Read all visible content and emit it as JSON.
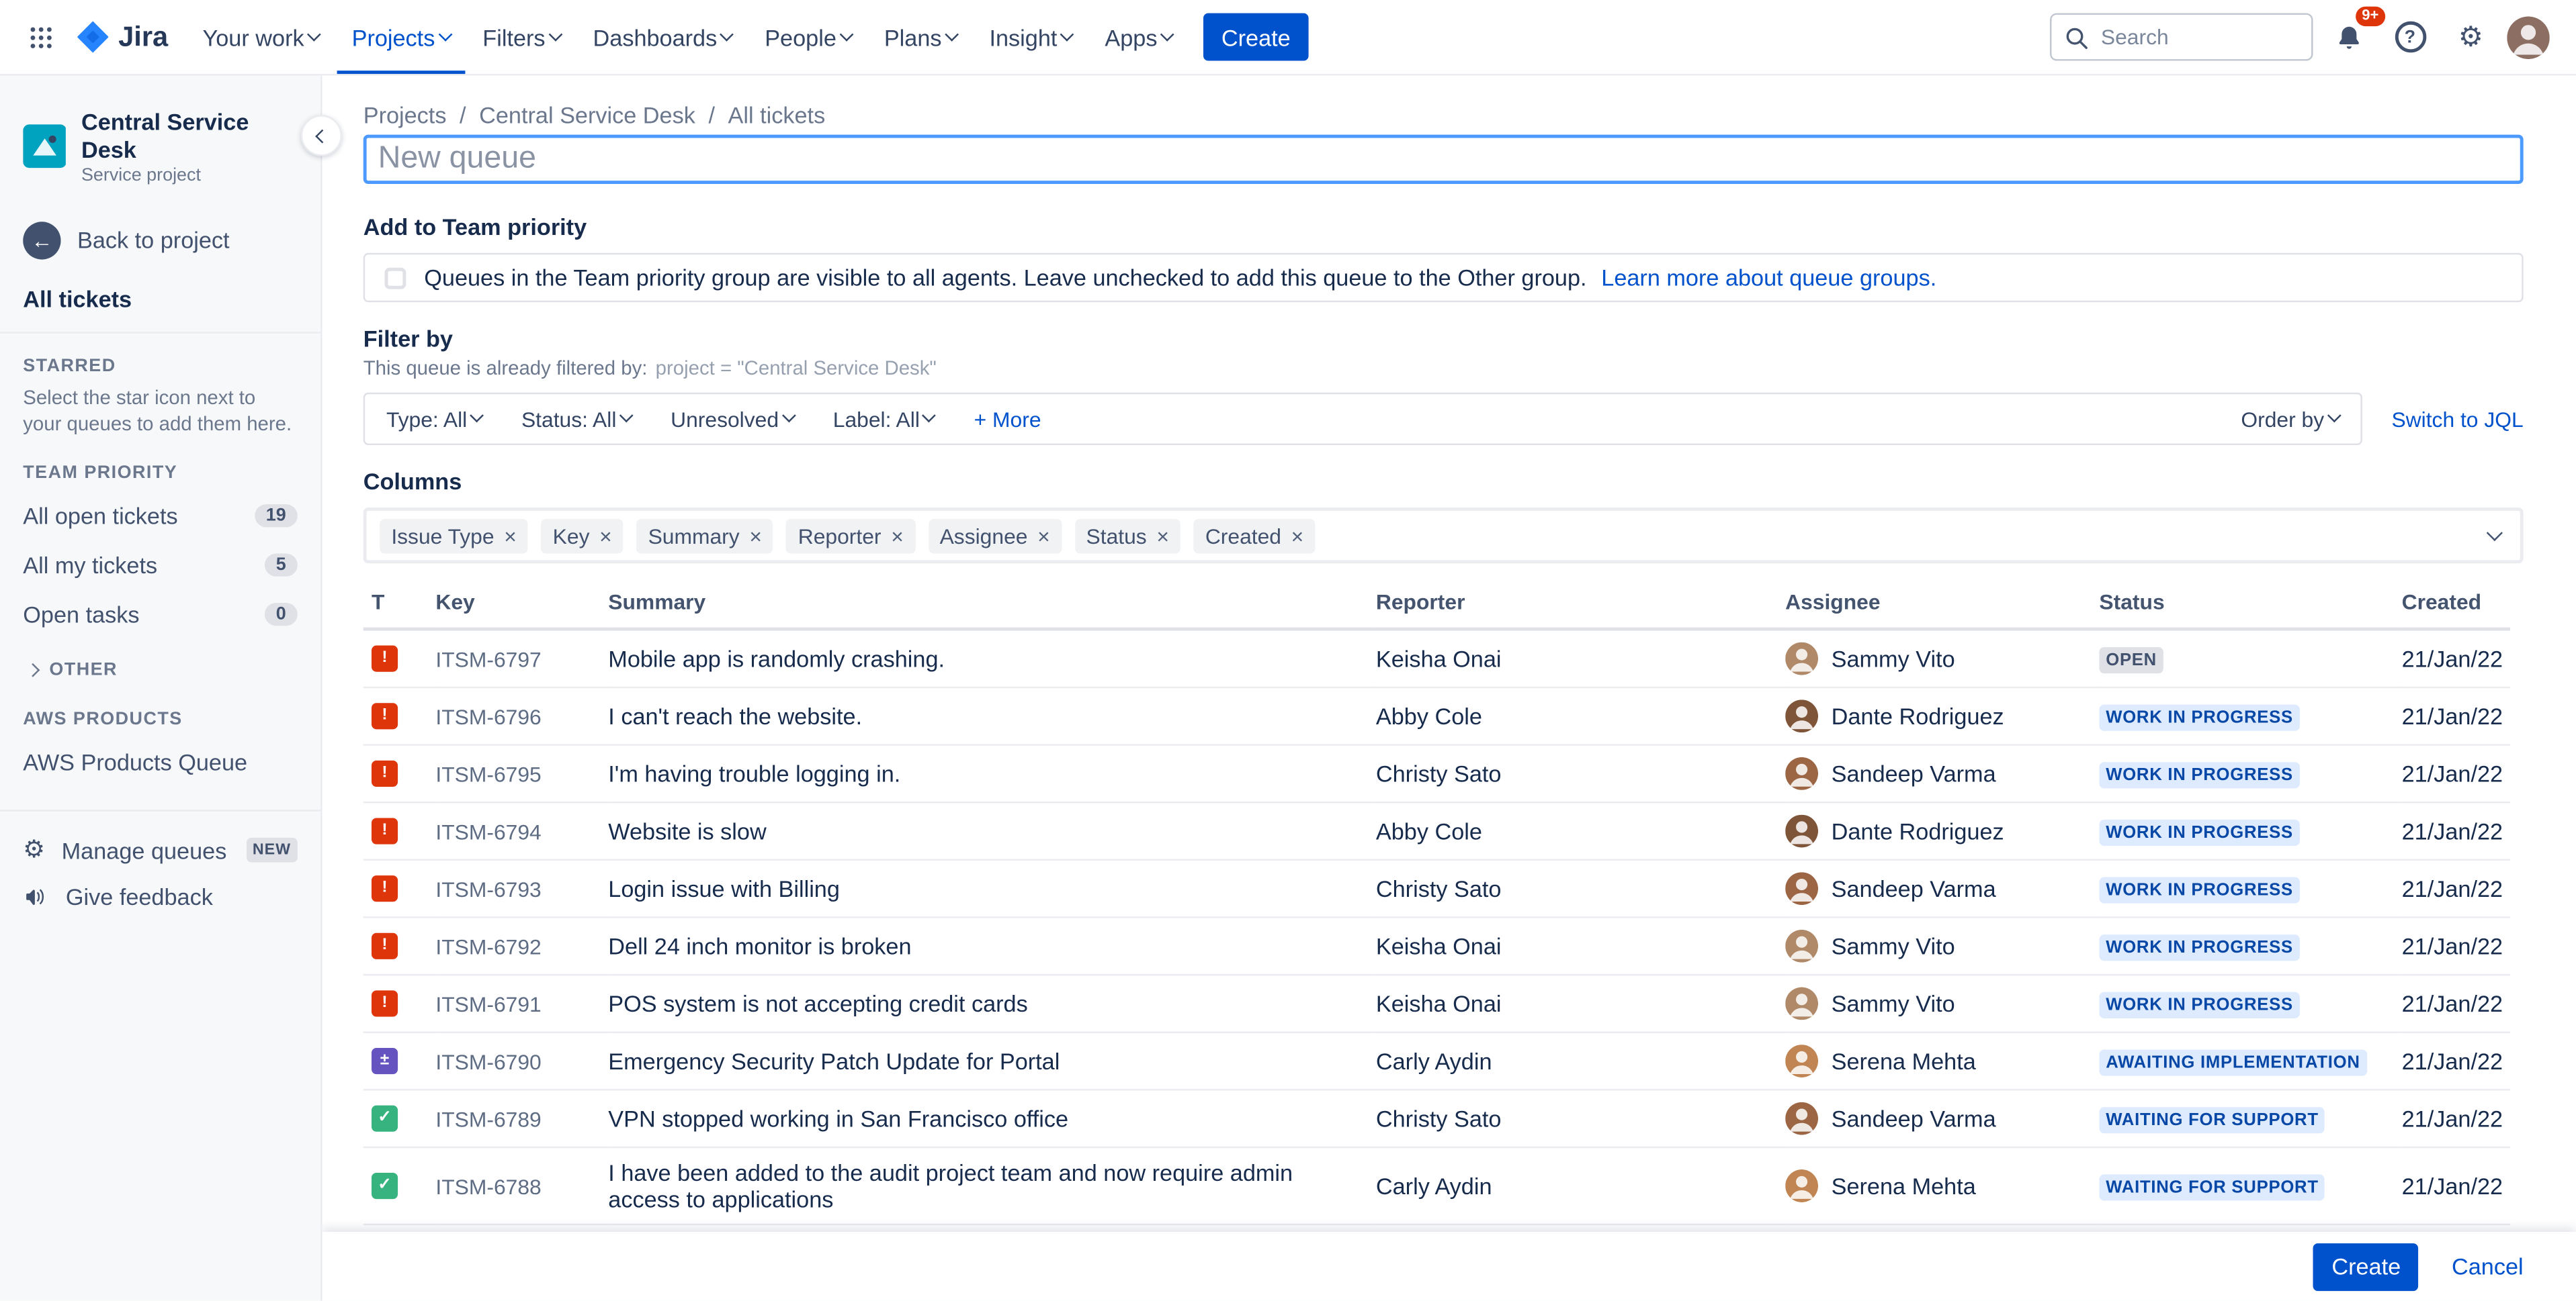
{
  "icons": {
    "gear": "⚙",
    "help": "?",
    "back_arrow": "←",
    "remove": "×"
  },
  "colors": {
    "brand": "#0052CC",
    "focus_border": "#4C9AFF"
  },
  "navbar": {
    "logo_text": "Jira",
    "items": [
      {
        "label": "Your work"
      },
      {
        "label": "Projects"
      },
      {
        "label": "Filters"
      },
      {
        "label": "Dashboards"
      },
      {
        "label": "People"
      },
      {
        "label": "Plans"
      },
      {
        "label": "Insight"
      },
      {
        "label": "Apps"
      }
    ],
    "active_item": "Projects",
    "create_label": "Create",
    "search_placeholder": "Search",
    "notification_count": "9+"
  },
  "sidebar": {
    "project_name": "Central Service Desk",
    "project_type": "Service project",
    "back_label": "Back to project",
    "all_tickets_label": "All tickets",
    "starred_heading": "STARRED",
    "starred_hint": "Select the star icon next to your queues to add them here.",
    "team_priority_heading": "TEAM PRIORITY",
    "queues": [
      {
        "label": "All open tickets",
        "count": "19"
      },
      {
        "label": "All my tickets",
        "count": "5"
      },
      {
        "label": "Open tasks",
        "count": "0"
      }
    ],
    "other_heading": "OTHER",
    "aws_heading": "AWS PRODUCTS",
    "aws_item": "AWS Products Queue",
    "manage_queues_label": "Manage queues",
    "manage_queues_badge": "NEW",
    "give_feedback_label": "Give feedback"
  },
  "breadcrumb": [
    "Projects",
    "Central Service Desk",
    "All tickets"
  ],
  "form": {
    "name_placeholder": "New queue",
    "team_priority_heading": "Add to Team priority",
    "team_priority_text": "Queues in the Team priority group are visible to all agents. Leave unchecked to add this queue to the Other group.",
    "team_priority_link": "Learn more about queue groups.",
    "filter_heading": "Filter by",
    "filter_note": "This queue is already filtered by:",
    "filter_code": "project = \"Central Service Desk\"",
    "filters": [
      "Type: All",
      "Status: All",
      "Unresolved",
      "Label: All"
    ],
    "more_label": "+ More",
    "order_by_label": "Order by",
    "switch_jql_label": "Switch to JQL",
    "columns_heading": "Columns",
    "column_chips": [
      "Issue Type",
      "Key",
      "Summary",
      "Reporter",
      "Assignee",
      "Status",
      "Created"
    ]
  },
  "table": {
    "headers": [
      "T",
      "Key",
      "Summary",
      "Reporter",
      "Assignee",
      "Status",
      "Created"
    ],
    "type_icons": {
      "incident": {
        "color": "#DE350B",
        "glyph": "!"
      },
      "change": {
        "color": "#6554C0",
        "glyph": "±"
      },
      "service-request": {
        "color": "#36B37E",
        "glyph": "✓"
      }
    },
    "status_colors": {
      "todo": {
        "bg": "#DFE1E6",
        "text": "#42526E"
      },
      "inprogress": {
        "bg": "#DEEBFF",
        "text": "#0747A6"
      }
    },
    "rows": [
      {
        "type": "incident",
        "key": "ITSM-6797",
        "summary": "Mobile app is randomly crashing.",
        "reporter": "Keisha Onai",
        "assignee": "Sammy Vito",
        "avatar_color": "#B08968",
        "status": "OPEN",
        "status_category": "todo",
        "created": "21/Jan/22"
      },
      {
        "type": "incident",
        "key": "ITSM-6796",
        "summary": "I can't reach the website.",
        "reporter": "Abby Cole",
        "assignee": "Dante Rodriguez",
        "avatar_color": "#7F5539",
        "status": "WORK IN PROGRESS",
        "status_category": "inprogress",
        "created": "21/Jan/22"
      },
      {
        "type": "incident",
        "key": "ITSM-6795",
        "summary": "I'm having trouble logging in.",
        "reporter": "Christy Sato",
        "assignee": "Sandeep Varma",
        "avatar_color": "#9C6644",
        "status": "WORK IN PROGRESS",
        "status_category": "inprogress",
        "created": "21/Jan/22"
      },
      {
        "type": "incident",
        "key": "ITSM-6794",
        "summary": "Website is slow",
        "reporter": "Abby Cole",
        "assignee": "Dante Rodriguez",
        "avatar_color": "#7F5539",
        "status": "WORK IN PROGRESS",
        "status_category": "inprogress",
        "created": "21/Jan/22"
      },
      {
        "type": "incident",
        "key": "ITSM-6793",
        "summary": "Login issue with Billing",
        "reporter": "Christy Sato",
        "assignee": "Sandeep Varma",
        "avatar_color": "#9C6644",
        "status": "WORK IN PROGRESS",
        "status_category": "inprogress",
        "created": "21/Jan/22"
      },
      {
        "type": "incident",
        "key": "ITSM-6792",
        "summary": "Dell 24 inch monitor is broken",
        "reporter": "Keisha Onai",
        "assignee": "Sammy Vito",
        "avatar_color": "#B08968",
        "status": "WORK IN PROGRESS",
        "status_category": "inprogress",
        "created": "21/Jan/22"
      },
      {
        "type": "incident",
        "key": "ITSM-6791",
        "summary": "POS system is not accepting credit cards",
        "reporter": "Keisha Onai",
        "assignee": "Sammy Vito",
        "avatar_color": "#B08968",
        "status": "WORK IN PROGRESS",
        "status_category": "inprogress",
        "created": "21/Jan/22"
      },
      {
        "type": "change",
        "key": "ITSM-6790",
        "summary": "Emergency Security Patch Update for Portal",
        "reporter": "Carly Aydin",
        "assignee": "Serena Mehta",
        "avatar_color": "#C08552",
        "status": "AWAITING IMPLEMENTATION",
        "status_category": "inprogress",
        "created": "21/Jan/22"
      },
      {
        "type": "service-request",
        "key": "ITSM-6789",
        "summary": "VPN stopped working in San Francisco office",
        "reporter": "Christy Sato",
        "assignee": "Sandeep Varma",
        "avatar_color": "#9C6644",
        "status": "WAITING FOR SUPPORT",
        "status_category": "inprogress",
        "created": "21/Jan/22"
      },
      {
        "type": "service-request",
        "key": "ITSM-6788",
        "summary": "I have been added to the audit project team and now require admin access to applications",
        "reporter": "Carly Aydin",
        "assignee": "Serena Mehta",
        "avatar_color": "#C08552",
        "status": "WAITING FOR SUPPORT",
        "status_category": "inprogress",
        "created": "21/Jan/22"
      },
      {
        "type": "service-request",
        "partial": true,
        "key": "",
        "summary": "",
        "reporter": "",
        "assignee": "",
        "avatar_color": "#C1C7D0",
        "status": "",
        "status_category": "",
        "created": ""
      }
    ]
  },
  "footer": {
    "create_label": "Create",
    "cancel_label": "Cancel"
  }
}
